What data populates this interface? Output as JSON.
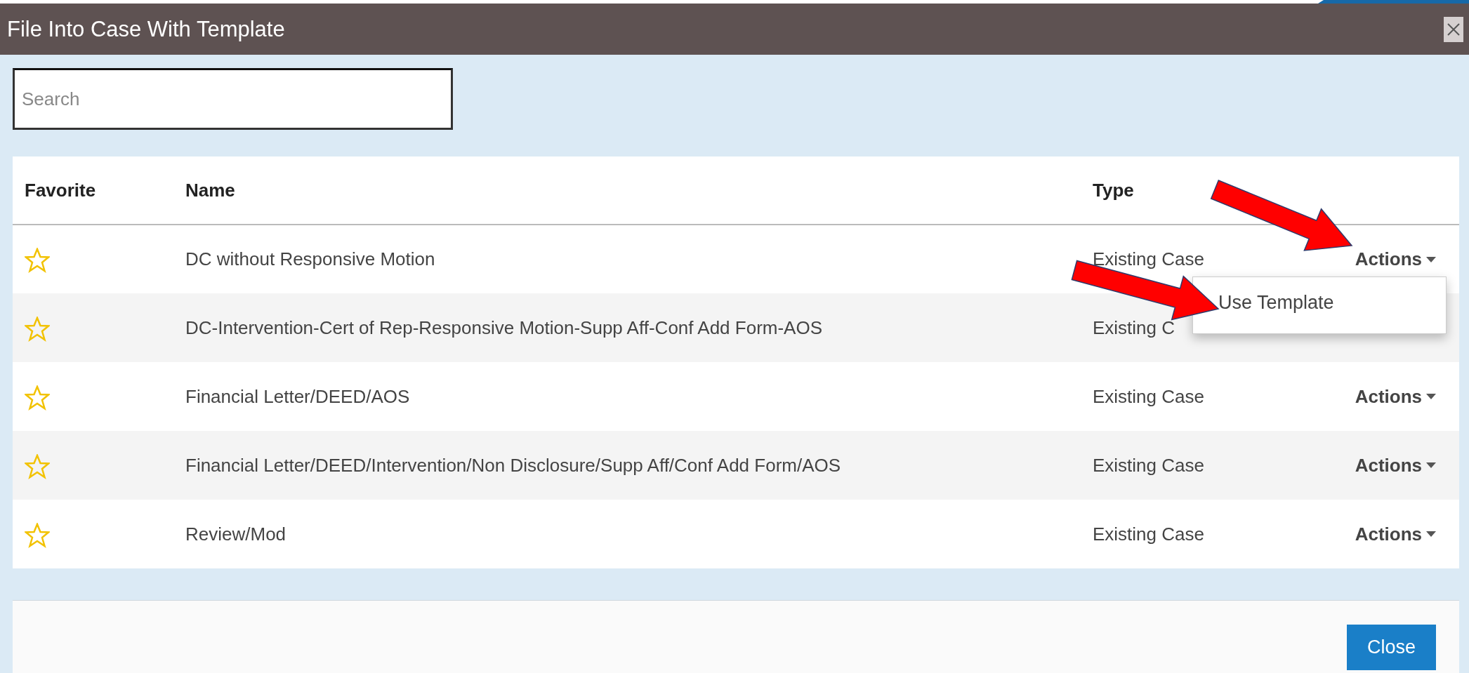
{
  "dialog": {
    "title": "File Into Case With Template"
  },
  "search": {
    "placeholder": "Search"
  },
  "table": {
    "columns": [
      "Favorite",
      "Name",
      "Type"
    ],
    "rows": [
      {
        "favorite": false,
        "name": "DC without Responsive Motion",
        "type": "Existing Case",
        "actions": {
          "label": "Actions",
          "expanded": true
        }
      },
      {
        "favorite": false,
        "name": "DC-Intervention-Cert of Rep-Responsive Motion-Supp Aff-Conf Add Form-AOS",
        "type": "Existing C"
      },
      {
        "favorite": false,
        "name": "Financial Letter/DEED/AOS",
        "type": "Existing Case",
        "actions": {
          "label": "Actions",
          "expanded": false
        }
      },
      {
        "favorite": false,
        "name": "Financial Letter/DEED/Intervention/Non Disclosure/Supp Aff/Conf Add Form/AOS",
        "type": "Existing Case",
        "actions": {
          "label": "Actions",
          "expanded": false
        }
      },
      {
        "favorite": false,
        "name": "Review/Mod",
        "type": "Existing Case",
        "actions": {
          "label": "Actions",
          "expanded": false
        }
      }
    ]
  },
  "actions_menu": {
    "items": [
      "Use Template"
    ]
  },
  "footer": {
    "buttons": [
      "Close"
    ]
  }
}
